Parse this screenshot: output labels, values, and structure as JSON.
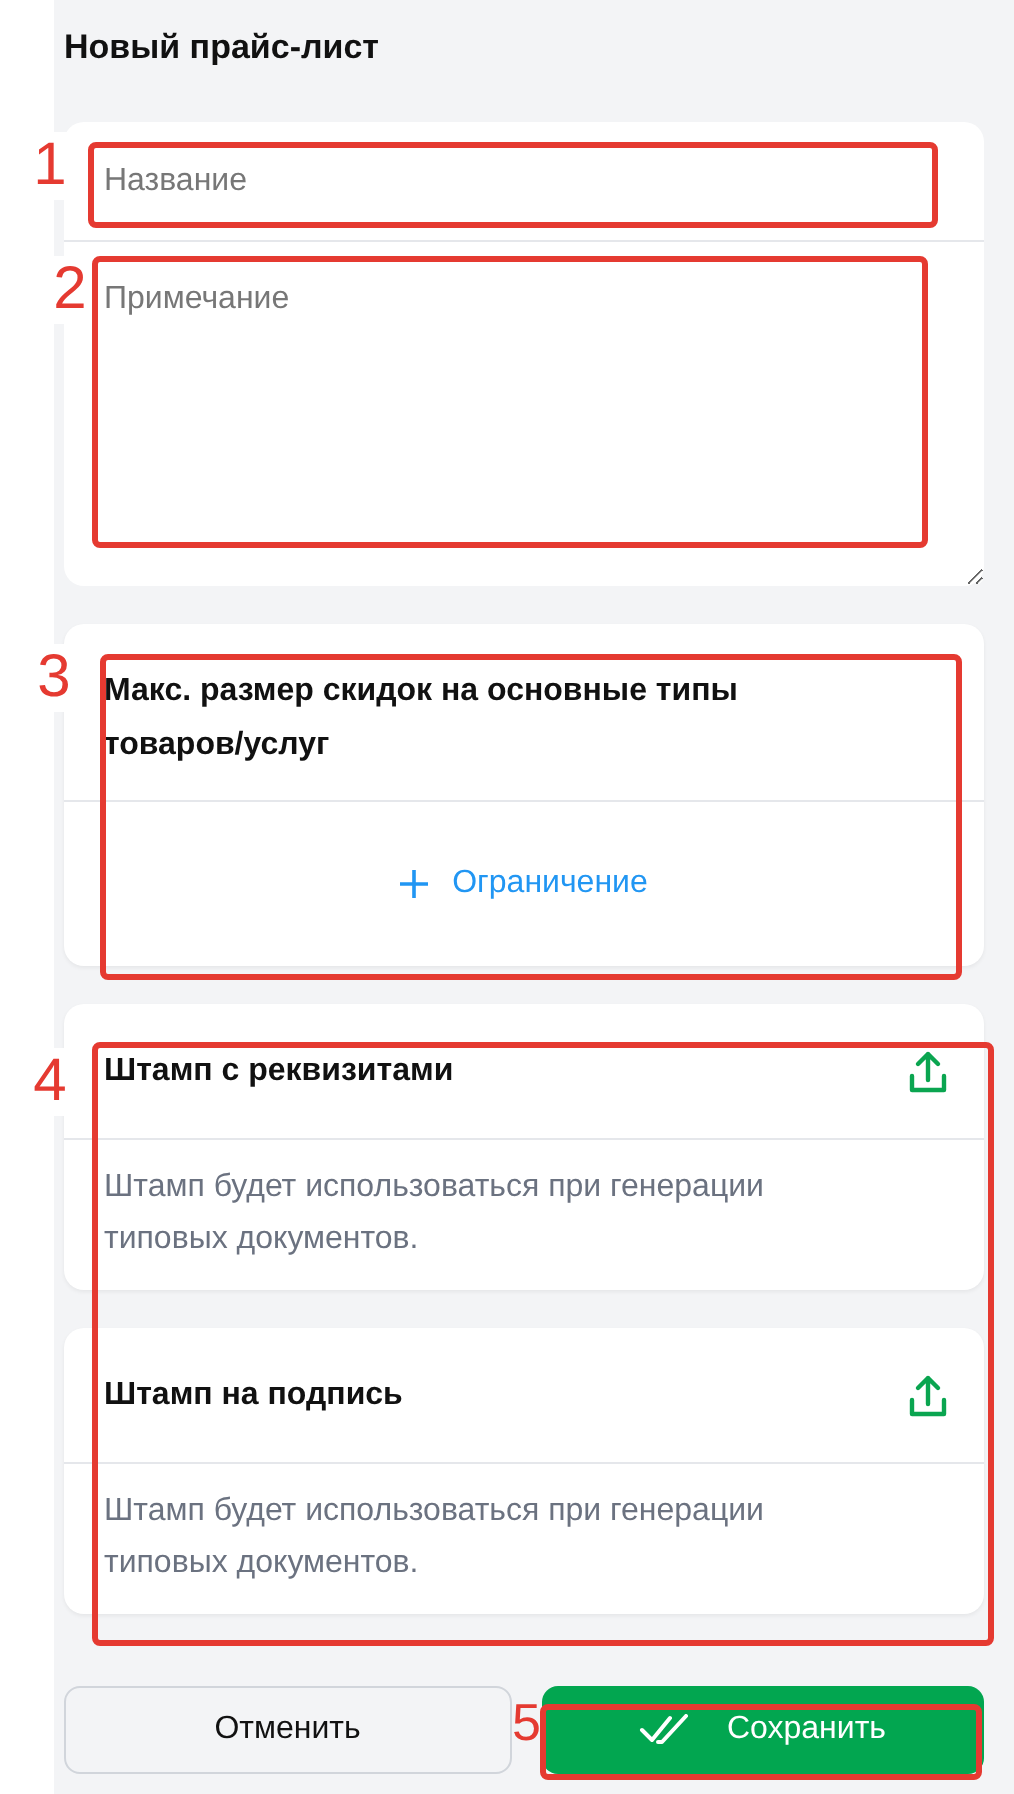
{
  "title": "Новый прайс-лист",
  "name_field": {
    "placeholder": "Название"
  },
  "note_field": {
    "placeholder": "Примечание"
  },
  "discount_card": {
    "title": "Макс. размер скидок на основные типы товаров/услуг",
    "add_button": "Ограничение"
  },
  "stamps": [
    {
      "title": "Штамп с реквизитами",
      "description": "Штамп будет использоваться при генерации типовых документов."
    },
    {
      "title": "Штамп на подпись",
      "description": "Штамп будет использоваться при генерации типовых документов."
    }
  ],
  "buttons": {
    "cancel": "Отменить",
    "save": "Сохранить"
  },
  "annotations": [
    {
      "label": "1"
    },
    {
      "label": "2"
    },
    {
      "label": "3"
    },
    {
      "label": "4"
    },
    {
      "label": "5"
    }
  ]
}
